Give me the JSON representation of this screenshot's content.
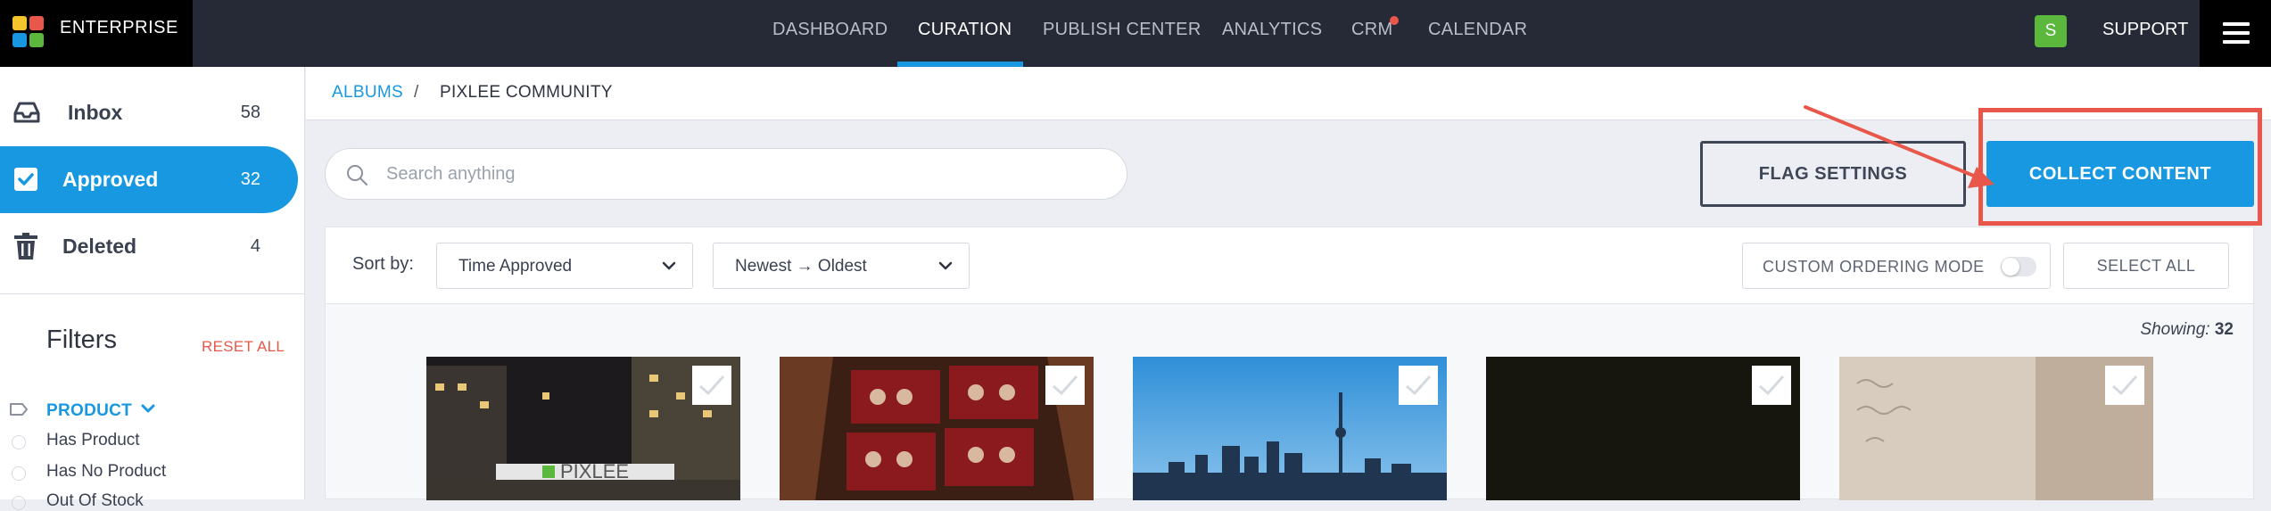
{
  "brand": {
    "name": "ENTERPRISE"
  },
  "nav": {
    "items": [
      "DASHBOARD",
      "CURATION",
      "PUBLISH CENTER",
      "ANALYTICS",
      "CRM",
      "CALENDAR"
    ],
    "active": "CURATION",
    "avatar_letter": "S",
    "support": "SUPPORT"
  },
  "sidebar": {
    "items": [
      {
        "label": "Inbox",
        "count": "58",
        "icon": "inbox-icon"
      },
      {
        "label": "Approved",
        "count": "32",
        "icon": "checkbox-icon"
      },
      {
        "label": "Deleted",
        "count": "4",
        "icon": "trash-icon"
      }
    ],
    "filters_title": "Filters",
    "reset_all": "RESET ALL",
    "product_filter": {
      "label": "PRODUCT",
      "options": [
        "Has Product",
        "Has No Product",
        "Out Of Stock"
      ]
    }
  },
  "breadcrumb": {
    "albums": "ALBUMS",
    "separator": "/",
    "current": "PIXLEE COMMUNITY"
  },
  "search": {
    "placeholder": "Search anything",
    "value": ""
  },
  "actions": {
    "flag_settings": "FLAG SETTINGS",
    "collect_content": "COLLECT CONTENT"
  },
  "toolbar": {
    "sort_label": "Sort by:",
    "sort_field": "Time Approved",
    "sort_order": "Newest → Oldest",
    "custom_ordering": "CUSTOM ORDERING MODE",
    "custom_ordering_on": false,
    "select_all": "SELECT ALL"
  },
  "showing": {
    "label": "Showing:",
    "count": "32"
  },
  "colors": {
    "accent": "#1798e1",
    "danger": "#e8574a",
    "nav_bg": "#252a36",
    "approved": "#1798e1"
  }
}
